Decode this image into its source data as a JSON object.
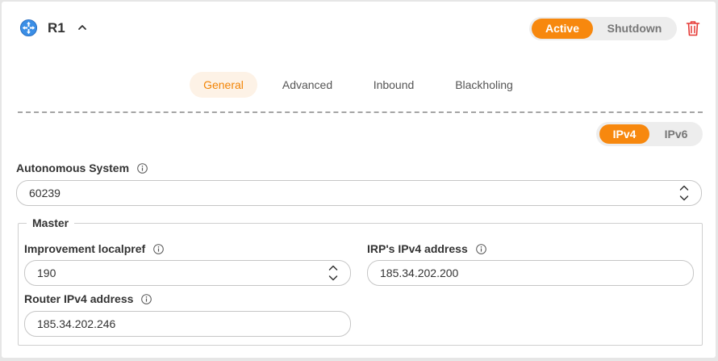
{
  "header": {
    "title": "R1",
    "status_active": "Active",
    "status_shutdown": "Shutdown",
    "router_icon": "router-icon",
    "collapse_icon": "chevron-up-icon",
    "delete_icon": "trash-icon"
  },
  "tabs": [
    {
      "label": "General",
      "selected": true
    },
    {
      "label": "Advanced",
      "selected": false
    },
    {
      "label": "Inbound",
      "selected": false
    },
    {
      "label": "Blackholing",
      "selected": false
    }
  ],
  "ip_version": {
    "ipv4": "IPv4",
    "ipv6": "IPv6",
    "selected": "IPv4"
  },
  "form": {
    "autonomous_system": {
      "label": "Autonomous System",
      "value": "60239"
    },
    "master": {
      "legend": "Master",
      "improvement_localpref": {
        "label": "Improvement localpref",
        "value": "190"
      },
      "irp_ipv4": {
        "label": "IRP's IPv4 address",
        "value": "185.34.202.200"
      },
      "router_ipv4": {
        "label": "Router IPv4 address",
        "value": "185.34.202.246"
      }
    }
  },
  "colors": {
    "accent": "#f7880e",
    "accent_light": "#fdf2e6",
    "danger": "#e53935",
    "icon_blue": "#3a8ee6"
  }
}
